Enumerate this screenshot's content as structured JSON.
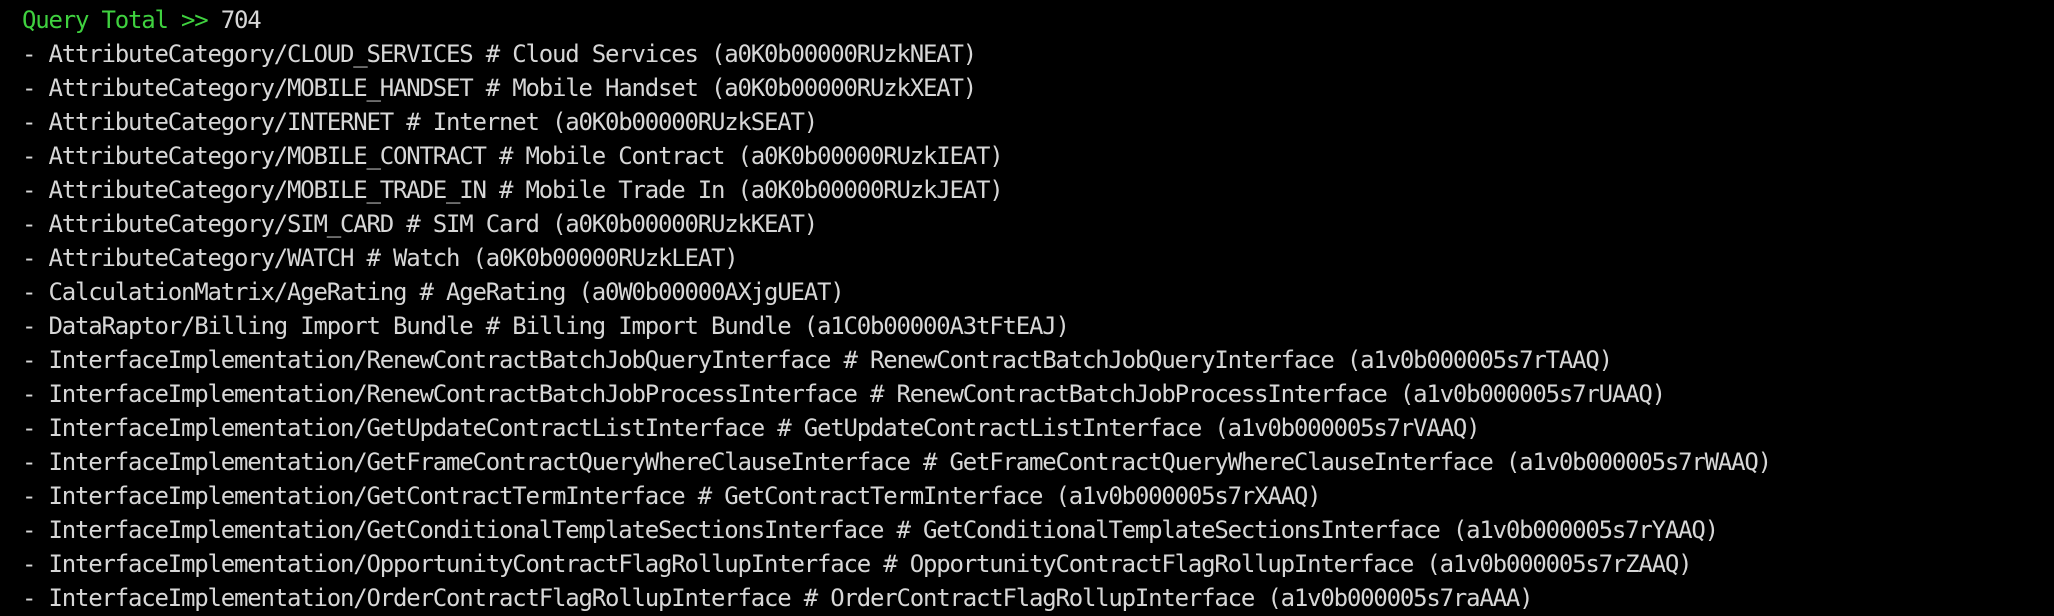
{
  "terminal": {
    "query_label": "Query Total >> ",
    "query_total": "704",
    "colors": {
      "background": "#000000",
      "text": "#d7d7d7",
      "label": "#3fd13f"
    },
    "lines": [
      "- AttributeCategory/CLOUD_SERVICES # Cloud Services (a0K0b00000RUzkNEAT)",
      "- AttributeCategory/MOBILE_HANDSET # Mobile Handset (a0K0b00000RUzkXEAT)",
      "- AttributeCategory/INTERNET # Internet (a0K0b00000RUzkSEAT)",
      "- AttributeCategory/MOBILE_CONTRACT # Mobile Contract (a0K0b00000RUzkIEAT)",
      "- AttributeCategory/MOBILE_TRADE_IN # Mobile Trade In (a0K0b00000RUzkJEAT)",
      "- AttributeCategory/SIM_CARD # SIM Card (a0K0b00000RUzkKEAT)",
      "- AttributeCategory/WATCH # Watch (a0K0b00000RUzkLEAT)",
      "- CalculationMatrix/AgeRating # AgeRating (a0W0b00000AXjgUEAT)",
      "- DataRaptor/Billing Import Bundle # Billing Import Bundle (a1C0b00000A3tFtEAJ)",
      "- InterfaceImplementation/RenewContractBatchJobQueryInterface # RenewContractBatchJobQueryInterface (a1v0b000005s7rTAAQ)",
      "- InterfaceImplementation/RenewContractBatchJobProcessInterface # RenewContractBatchJobProcessInterface (a1v0b000005s7rUAAQ)",
      "- InterfaceImplementation/GetUpdateContractListInterface # GetUpdateContractListInterface (a1v0b000005s7rVAAQ)",
      "- InterfaceImplementation/GetFrameContractQueryWhereClauseInterface # GetFrameContractQueryWhereClauseInterface (a1v0b000005s7rWAAQ)",
      "- InterfaceImplementation/GetContractTermInterface # GetContractTermInterface (a1v0b000005s7rXAAQ)",
      "- InterfaceImplementation/GetConditionalTemplateSectionsInterface # GetConditionalTemplateSectionsInterface (a1v0b000005s7rYAAQ)",
      "- InterfaceImplementation/OpportunityContractFlagRollupInterface # OpportunityContractFlagRollupInterface (a1v0b000005s7rZAAQ)",
      "- InterfaceImplementation/OrderContractFlagRollupInterface # OrderContractFlagRollupInterface (a1v0b000005s7raAAA)"
    ]
  }
}
